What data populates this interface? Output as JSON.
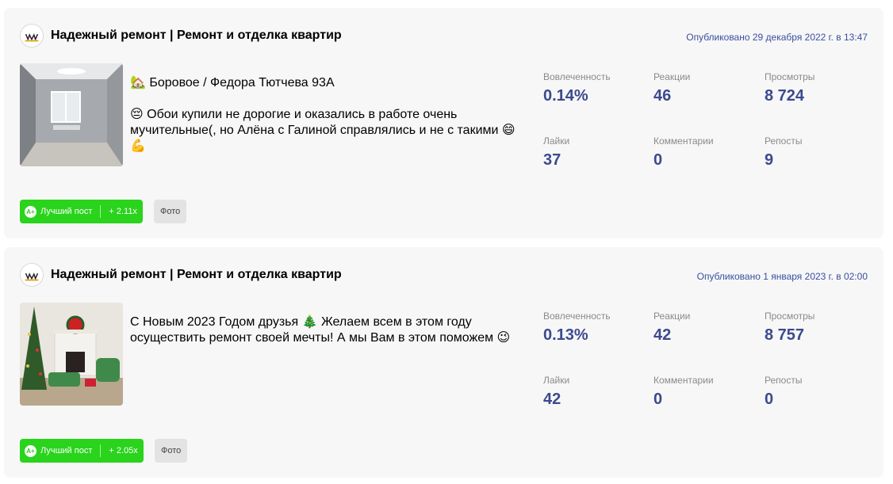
{
  "posts": [
    {
      "group_name": "Надежный ремонт | Ремонт и отделка квартир",
      "published": "Опубликовано 29 декабря 2022 г. в 13:47",
      "text_lines": [
        "🏡 Боровое / Федора Тютчева 93А",
        "😔 Обои купили не дорогие и оказались в работе очень мучительные(, но Алёна с Галиной справлялись и не с такими 😄💪"
      ],
      "stats": {
        "engagement": {
          "label": "Вовлеченность",
          "value": "0.14%"
        },
        "reactions": {
          "label": "Реакции",
          "value": "46"
        },
        "views": {
          "label": "Просмотры",
          "value": "8 724"
        },
        "likes": {
          "label": "Лайки",
          "value": "37"
        },
        "comments": {
          "label": "Комментарии",
          "value": "0"
        },
        "reposts": {
          "label": "Репосты",
          "value": "9"
        }
      },
      "badge": {
        "icon": "A+",
        "label": "Лучший пост",
        "multiplier": "+ 2.11x"
      },
      "type_tag": "Фото"
    },
    {
      "group_name": "Надежный ремонт | Ремонт и отделка квартир",
      "published": "Опубликовано 1 января 2023 г. в 02:00",
      "text_lines": [
        "С Новым 2023 Годом друзья 🎄 Желаем всем в этом году осуществить ремонт своей мечты! А мы Вам в этом поможем 😉"
      ],
      "stats": {
        "engagement": {
          "label": "Вовлеченность",
          "value": "0.13%"
        },
        "reactions": {
          "label": "Реакции",
          "value": "42"
        },
        "views": {
          "label": "Просмотры",
          "value": "8 757"
        },
        "likes": {
          "label": "Лайки",
          "value": "42"
        },
        "comments": {
          "label": "Комментарии",
          "value": "0"
        },
        "reposts": {
          "label": "Репосты",
          "value": "0"
        }
      },
      "badge": {
        "icon": "A+",
        "label": "Лучший пост",
        "multiplier": "+ 2.05x"
      },
      "type_tag": "Фото"
    }
  ],
  "colors": {
    "card_bg": "#f7f7f7",
    "stat_value": "#3b4a8e",
    "published": "#3b4fa0",
    "badge_green": "#2ad31c"
  }
}
